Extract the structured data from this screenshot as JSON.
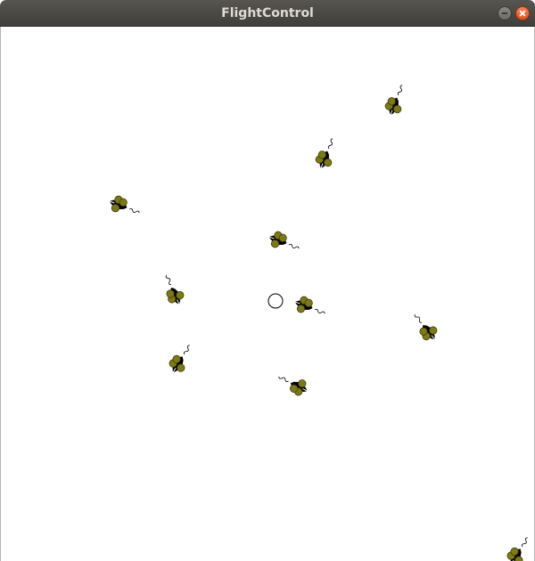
{
  "window": {
    "title": "FlightControl"
  },
  "game": {
    "colors": {
      "background": "#ffffff",
      "aircraft_body": "#000000",
      "engine": "#7d7a16",
      "engine_outline": "#3f3d0a",
      "target_outline": "#000000"
    }
  }
}
